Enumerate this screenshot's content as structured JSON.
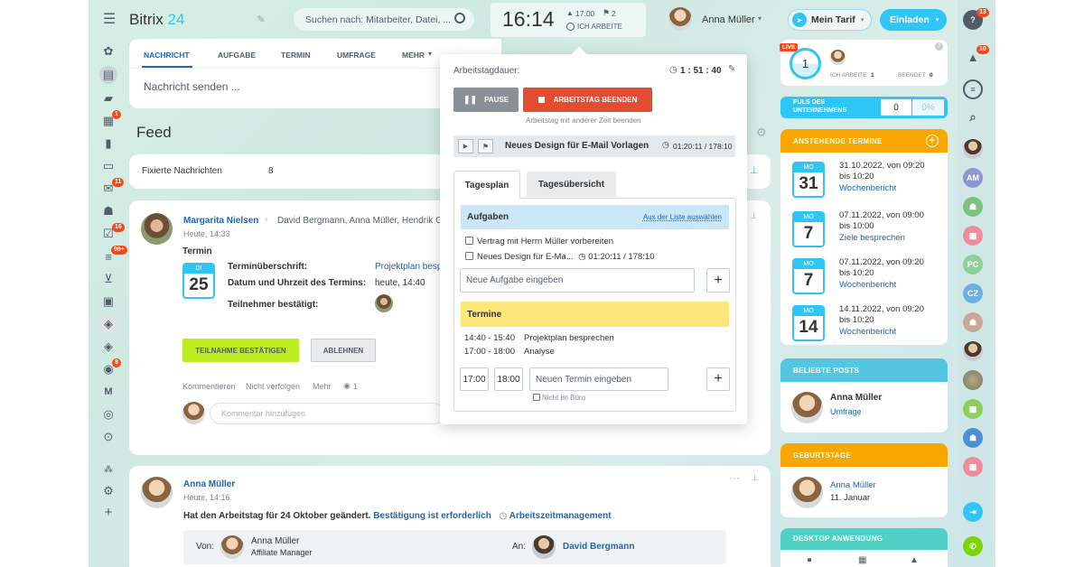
{
  "header": {
    "logo": "Bitrix",
    "logo_num": "24",
    "search_placeholder": "Suchen nach: Mitarbeiter, Datei, ...",
    "clock_time": "16:14",
    "clock_start": "17:00",
    "clock_flag_count": "2",
    "clock_status": "ICH ARBEITE",
    "user_name": "Anna Müller",
    "plan_label": "Mein Tarif",
    "invite_label": "Einladen"
  },
  "left_badges": {
    "calendar": "1",
    "mail": "11",
    "tasks": "16",
    "filter": "99+",
    "robot": "8"
  },
  "left_letter": "M",
  "composer": {
    "tabs": [
      "NACHRICHT",
      "AUFGABE",
      "TERMIN",
      "UMFRAGE",
      "MEHR"
    ],
    "placeholder": "Nachricht senden ..."
  },
  "feed": {
    "title": "Feed",
    "pinned_label": "Fixierte Nachrichten",
    "pinned_count": "8"
  },
  "post1": {
    "author": "Margarita Nielsen",
    "recipients": "David Bergmann, Anna Müller, Hendrik G",
    "time": "Heute, 14:33",
    "type": "Termin",
    "cal_month": "DI",
    "cal_day": "25",
    "f1_label": "Terminüberschrift:",
    "f1_value": "Projektplan besp",
    "f2_label": "Datum und Uhrzeit des Termins:",
    "f2_value": "heute, 14:40",
    "f3_label": "Teilnehmer bestätigt:",
    "confirm_btn": "TEILNAHME BESTÄTIGEN",
    "decline_btn": "ABLEHNEN",
    "act_comment": "Kommentieren",
    "act_unfollow": "Nicht verfolgen",
    "act_more": "Mehr",
    "views": "1",
    "comment_placeholder": "Kommentar hinzufügen"
  },
  "post2": {
    "author": "Anna Müller",
    "time": "Heute, 14:16",
    "text": "Hat den Arbeitstag für 24 Oktober geändert.",
    "link1": "Bestätigung ist erforderlich",
    "link2": "Arbeitszeitmanagement",
    "von_label": "Von:",
    "von_name": "Anna Müller",
    "von_role": "Affiliate Manager",
    "an_label": "An:",
    "an_name": "David Bergmann"
  },
  "popup": {
    "duration_label": "Arbeitstagdauer:",
    "duration_value": "1 : 51 : 40",
    "pause_btn": "PAUSE",
    "end_btn": "ARBEITSTAG BEENDEN",
    "other_time": "Arbeitstag mit anderer Zeit beenden",
    "task_name": "Neues Design für E-Mail Vorlagen",
    "task_time": "01:20:11 / 178:10",
    "tab1": "Tagesplan",
    "tab2": "Tagesübersicht",
    "aufgaben_title": "Aufgaben",
    "aufgaben_link": "Aus der Liste auswählen",
    "task1": "Vertrag mit Herrn Müller vorbereiten",
    "task2": "Neues Design für E-Ma...",
    "task2_time": "01:20:11 / 178:10",
    "new_task_placeholder": "Neue Aufgabe eingeben",
    "termine_title": "Termine",
    "ev1_time": "14:40 - 15:40",
    "ev1_name": "Projektplan besprechen",
    "ev2_time": "17:00 - 18:00",
    "ev2_name": "Analyse",
    "from_time": "17:00",
    "to_time": "18:00",
    "new_event_placeholder": "Neuen Termin eingeben",
    "not_in_office": "Nicht im Büro"
  },
  "right": {
    "live": "LIVE",
    "working_count": "1",
    "ich_arbeite_label": "ICH ARBEITE",
    "ich_arbeite_count": "1",
    "beendet_label": "BEENDET",
    "beendet_count": "0",
    "puls_line1": "PULS DES",
    "puls_line2": "UNTERNEHMENS",
    "puls_value": "0",
    "puls_pct": "0%",
    "termine_title": "ANSTEHENDE TERMINE",
    "events": [
      {
        "month": "MO",
        "day": "31",
        "line1": "31.10.2022, von 09:20",
        "line2": "bis 10:20",
        "title": "Wochenbericht"
      },
      {
        "month": "MO",
        "day": "7",
        "line1": "07.11.2022, von 09:00",
        "line2": "bis 10:00",
        "title": "Ziele besprechen"
      },
      {
        "month": "MO",
        "day": "7",
        "line1": "07.11.2022, von 09:20",
        "line2": "bis 10:20",
        "title": "Wochenbericht"
      },
      {
        "month": "MO",
        "day": "14",
        "line1": "14.11.2022, von 09:20",
        "line2": "bis 10:20",
        "title": "Wochenbericht"
      }
    ],
    "posts_title": "BELIEBTE POSTS",
    "post_author": "Anna Müller",
    "post_title": "Umfrage",
    "bday_title": "GEBURTSTAGE",
    "bday_name": "Anna Müller",
    "bday_date": "11. Januar",
    "desktop_title": "DESKTOP ANWENDUNG"
  },
  "rightbar": {
    "help_badge": "13",
    "bell_badge": "10",
    "initials1": "AM",
    "initials2": "PC",
    "initials3": "CZ"
  },
  "colors": {
    "accent": "#2fc6f6",
    "orange": "#f7a700",
    "green": "#bbed21",
    "red": "#f54819",
    "blue_link": "#2067b0"
  }
}
